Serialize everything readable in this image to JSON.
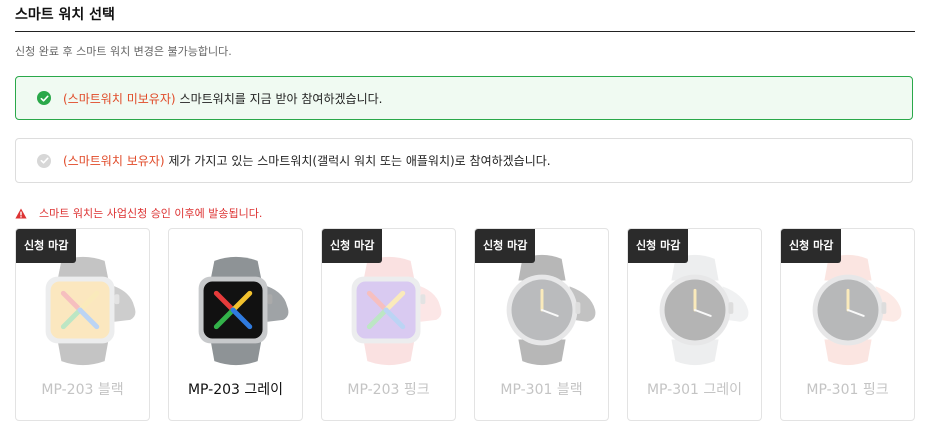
{
  "header": {
    "title": "스마트 워치 선택"
  },
  "notice": "신청 완료 후 스마트 워치 변경은 불가능합니다.",
  "options": [
    {
      "tag": "(스마트워치 미보유자)",
      "text": " 스마트워치를 지금 받아 참여하겠습니다.",
      "selected": true
    },
    {
      "tag": "(스마트워치 보유자)",
      "text": " 제가 가지고 있는 스마트워치(갤럭시 워치 또는 애플워치)로 참여하겠습니다.",
      "selected": false
    }
  ],
  "warning": "스마트 워치는 사업신청 승인 이후에 발송됩니다.",
  "colors": {
    "accent": "#2aa84a",
    "tag": "#e04a28",
    "warning": "#dd3333",
    "badge": "#2b2b2b"
  },
  "products": [
    {
      "name": "MP-203 블랙",
      "badge": "신청 마감",
      "state": "closed",
      "shape": "square",
      "strap": "#4a4a4a",
      "face": "#f3b83c"
    },
    {
      "name": "MP-203 그레이",
      "badge": "",
      "state": "available",
      "shape": "square",
      "strap": "#8e9396",
      "face": "#111111"
    },
    {
      "name": "MP-203 핑크",
      "badge": "신청 마감",
      "state": "closed",
      "shape": "square",
      "strap": "#f2a5a5",
      "face": "#8a5cd6"
    },
    {
      "name": "MP-301 블랙",
      "badge": "신청 마감",
      "state": "closed",
      "shape": "round",
      "strap": "#222222",
      "face": "#2b3035"
    },
    {
      "name": "MP-301 그레이",
      "badge": "신청 마감",
      "state": "closed",
      "shape": "round",
      "strap": "#c9ccce",
      "face": "#1a1a1a"
    },
    {
      "name": "MP-301 핑크",
      "badge": "신청 마감",
      "state": "closed",
      "shape": "round",
      "strap": "#f4b1a5",
      "face": "#22262a"
    }
  ]
}
